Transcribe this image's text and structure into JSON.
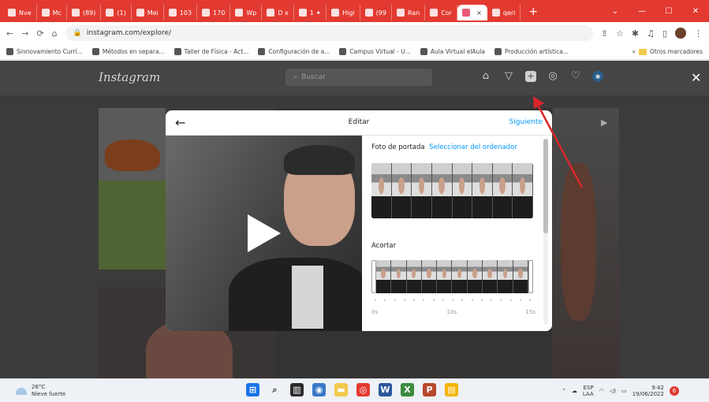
{
  "browser": {
    "tabs": [
      {
        "label": "Nve"
      },
      {
        "label": "Mc"
      },
      {
        "label": "(89)"
      },
      {
        "label": "(1)"
      },
      {
        "label": "Mei"
      },
      {
        "label": "103"
      },
      {
        "label": "170"
      },
      {
        "label": "Wp"
      },
      {
        "label": "D x"
      },
      {
        "label": "1 ✦"
      },
      {
        "label": "Higi"
      },
      {
        "label": "(99"
      },
      {
        "label": "Ran"
      },
      {
        "label": "Cor"
      },
      {
        "label": "",
        "active": true
      },
      {
        "label": "qeri"
      }
    ],
    "new_tab": "+",
    "url": "instagram.com/explore/",
    "bookmarks": [
      {
        "label": "Sinnovamiento Currí..."
      },
      {
        "label": "Métodos en separa..."
      },
      {
        "label": "Taller de Física - Act..."
      },
      {
        "label": "Configuración de a..."
      },
      {
        "label": "Campus Virtual - U..."
      },
      {
        "label": "Aula Virtual elAula"
      },
      {
        "label": "Producción artística..."
      }
    ],
    "bookmarks_folder": "Otros marcadores"
  },
  "instagram": {
    "logo": "Instagram",
    "search_placeholder": "Buscar"
  },
  "modal": {
    "title": "Editar",
    "next_label": "Siguiente",
    "cover_label": "Foto de portada",
    "cover_link": "Seleccionar del ordenador",
    "trim_label": "Acortar",
    "tick_labels": [
      "0s",
      "10s",
      "15s"
    ]
  },
  "taskbar": {
    "weather_temp": "26°C",
    "weather_desc": "Nieve fuerte",
    "lang": "ESP",
    "lang2": "LAA",
    "time": "9:42",
    "date": "19/06/2022",
    "notifications": "6"
  },
  "colors": {
    "tab_strip": "#e23a31",
    "link_blue": "#0095f6",
    "arrow_red": "#d9262b"
  }
}
